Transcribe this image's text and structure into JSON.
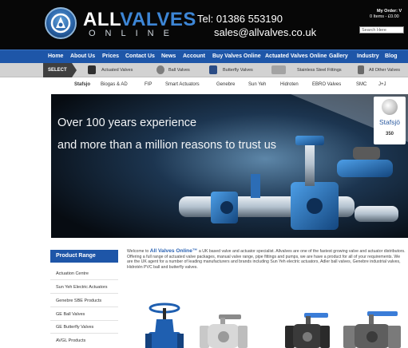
{
  "header": {
    "logo_all": "ALL",
    "logo_valves": "VALVES",
    "logo_online": "ONLINE",
    "tel": "Tel: 01386 553190",
    "email": "sales@allvalves.co.uk",
    "my_order": "My Order: V",
    "order_items": "0 Items - £0.00",
    "search_value": "Search Here"
  },
  "main_nav": [
    "Home",
    "About Us",
    "Prices",
    "Contact Us",
    "News",
    "Account",
    "Buy Valves Online",
    "Actuated Valves Online",
    "Gallery",
    "Industry",
    "Blog"
  ],
  "select_bar": {
    "label": "SELECT",
    "items": [
      "Actuated Valves",
      "Ball Valves",
      "Butterfly Valves",
      "Stainless Steel Fittings",
      "All Other Valves"
    ]
  },
  "brands": [
    "Stafsjo",
    "Biogas & AD",
    "FIP",
    "Smart Actuators",
    "Genebre",
    "Sun Yeh",
    "Hidroten",
    "EBRO Valves",
    "SMC",
    "J+J"
  ],
  "hero": {
    "line1": "Over 100 years experience",
    "line2": "and more than a million reasons to trust us",
    "logo_name": "Stafsjö",
    "logo_number": "350"
  },
  "sidebar": {
    "title": "Product Range",
    "items": [
      "Actuation Centre",
      "Sun Yeh Electric Actuators",
      "Genebre SBE Products",
      "GE Ball Valves",
      "GE Butterfly Valves",
      "AVGL Products"
    ]
  },
  "intro": {
    "prefix": "Welcome to ",
    "brand": "All Valves Online™",
    "body": " a UK based valve and actuator specialist. Allvalves are one of the fastest growing valve and actuator distributors. Offering a full range of actuated valve packages, manual valve range, pipe fittings and pumps, we are have a product for all of your requirements. We are the UK agent for a number of leading manufacturers and brands including Sun Yeh electric actuators, Adler ball valves, Genebre industrial valves, Hidrotén PVC ball and butterfly valves."
  },
  "colors": {
    "header_bg": "#070707",
    "nav_bg": "#1e56a8",
    "select_bar_bg": "#d2d2d2",
    "accent_blue": "#2a62b3"
  }
}
